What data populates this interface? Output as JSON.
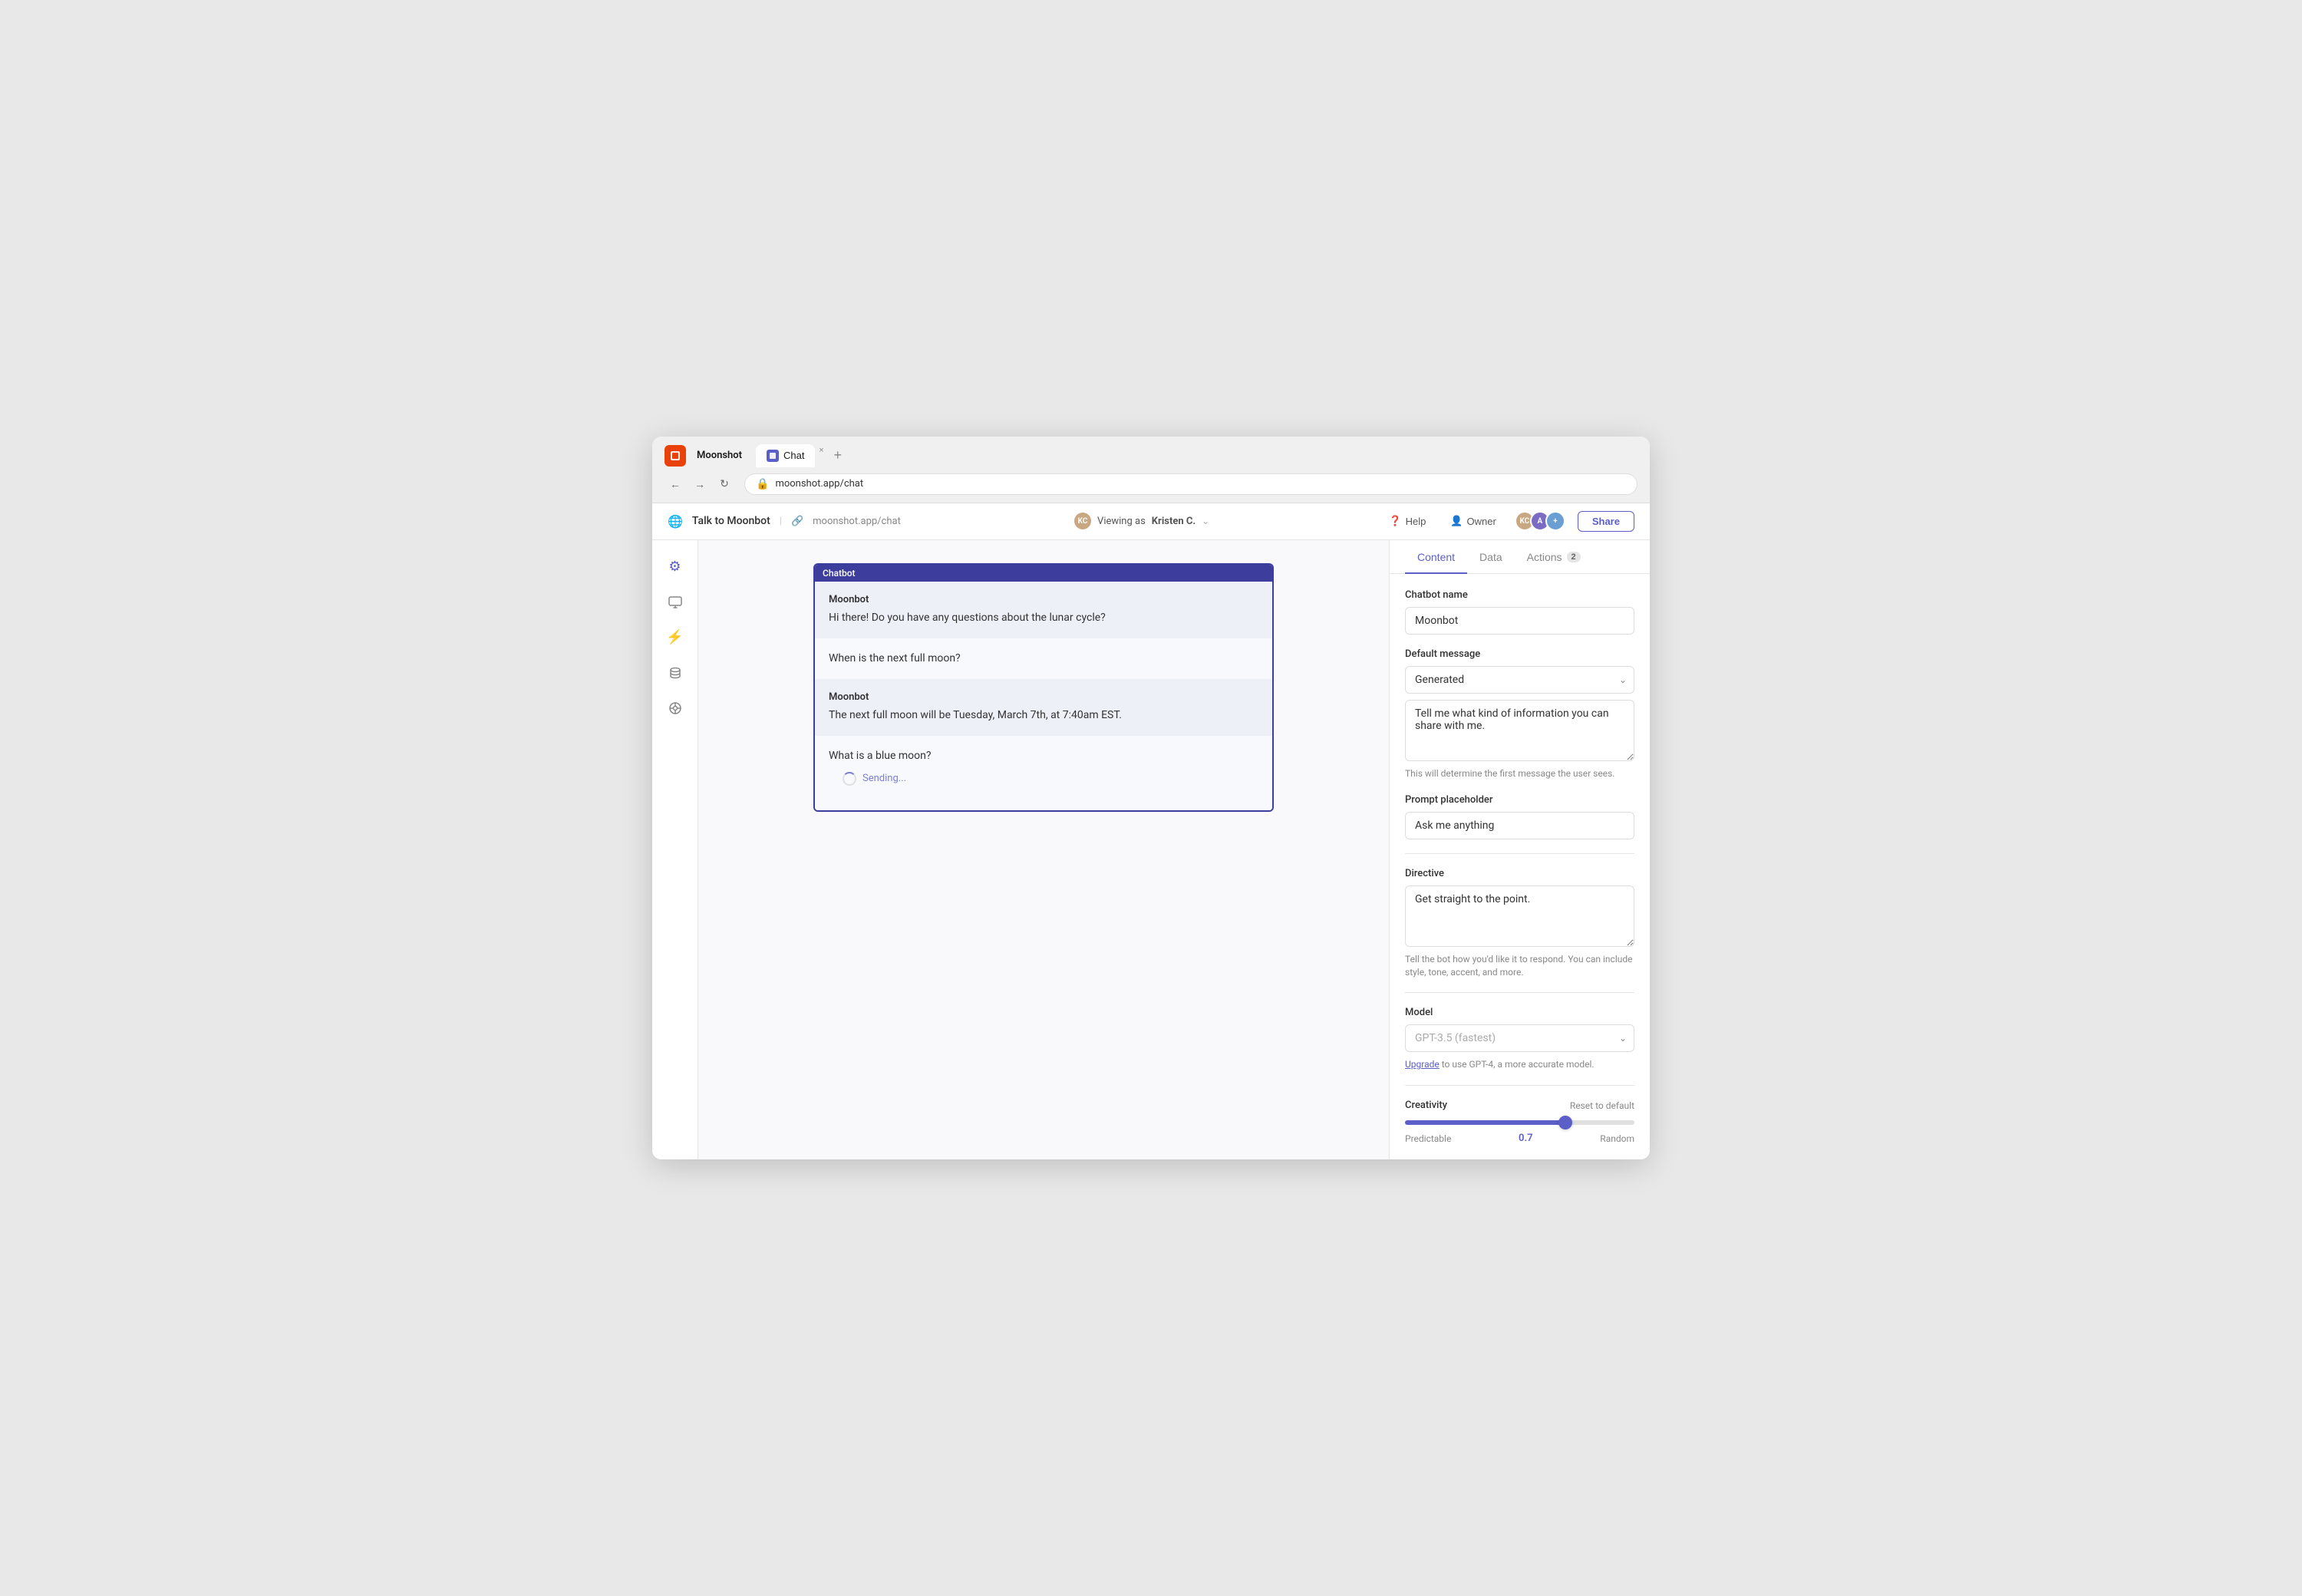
{
  "browser": {
    "app_name": "Moonshot",
    "tab_label": "Chat",
    "tab_close": "×",
    "tab_new": "+",
    "address_url": "moonshot.app/chat"
  },
  "header": {
    "site_label": "Talk to Moonbot",
    "url_display": "moonshot.app/chat",
    "viewing_as_prefix": "Viewing as",
    "viewing_as_user": "Kristen C.",
    "help_label": "Help",
    "owner_label": "Owner",
    "share_label": "Share"
  },
  "sidebar": {
    "icons": [
      "⚙",
      "▭",
      "⚡",
      "◈",
      "⚛"
    ]
  },
  "chat": {
    "chatbot_label": "Chatbot",
    "messages": [
      {
        "type": "bot",
        "sender": "Moonbot",
        "text": "Hi there! Do you have any questions about the lunar cycle?"
      },
      {
        "type": "user",
        "text": "When is the next full moon?"
      },
      {
        "type": "bot",
        "sender": "Moonbot",
        "text": "The next full moon will be Tuesday, March 7th, at 7:40am EST."
      },
      {
        "type": "user",
        "text": "What is a blue moon?"
      }
    ],
    "sending_text": "Sending..."
  },
  "panel": {
    "tabs": [
      {
        "label": "Content",
        "active": true
      },
      {
        "label": "Data",
        "active": false
      },
      {
        "label": "Actions",
        "active": false,
        "badge": "2"
      }
    ],
    "chatbot_name_label": "Chatbot name",
    "chatbot_name_value": "Moonbot",
    "default_message_label": "Default message",
    "default_message_option": "Generated",
    "default_message_text": "Tell me what kind of information you can share with me.",
    "default_message_hint": "This will determine the first message the user sees.",
    "prompt_placeholder_label": "Prompt placeholder",
    "prompt_placeholder_value": "Ask me anything",
    "directive_label": "Directive",
    "directive_value": "Get straight to the point.",
    "directive_hint": "Tell the bot how you'd like it to respond. You can include style, tone, accent, and more.",
    "model_label": "Model",
    "model_value": "GPT-3.5 (fastest)",
    "model_hint_prefix": "Upgrade",
    "model_hint_suffix": "to use GPT-4, a more accurate model.",
    "creativity_label": "Creativity",
    "reset_label": "Reset to default",
    "creativity_value": "0.7",
    "slider_left": "Predictable",
    "slider_right": "Random",
    "slider_percent": 70
  }
}
